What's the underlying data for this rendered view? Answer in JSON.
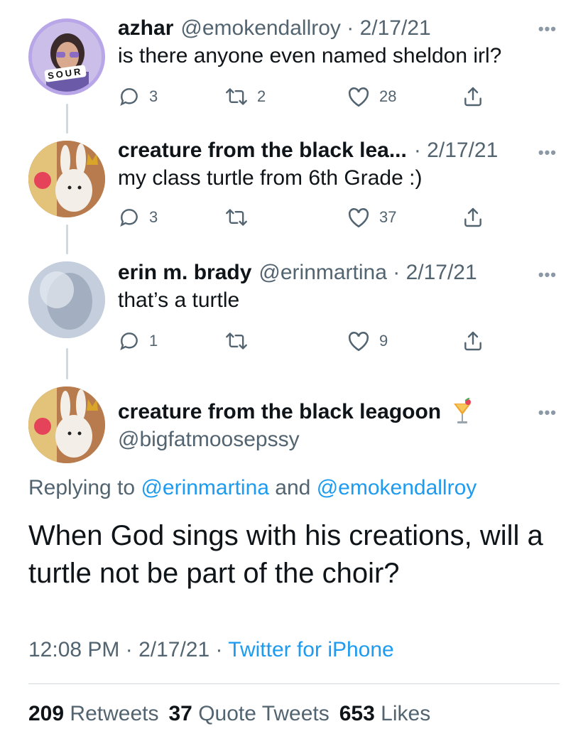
{
  "thread": [
    {
      "name": "azhar",
      "handle_date": "@emokendallroy · 2/17/21",
      "text": "is there anyone even named sheldon irl?",
      "replies": "3",
      "retweets": "2",
      "likes": "28",
      "avatar_badge": "SOUR"
    },
    {
      "name": "creature from the black lea...",
      "handle_date": "· 2/17/21",
      "text": "my class turtle from 6th Grade :)",
      "replies": "3",
      "retweets": "",
      "likes": "37"
    },
    {
      "name": "erin m. brady",
      "handle_date": "@erinmartina · 2/17/21",
      "text": "that’s a turtle",
      "replies": "1",
      "retweets": "",
      "likes": "9"
    }
  ],
  "main": {
    "name": "creature from the black leagoon",
    "handle": "@bigfatmoosepssy",
    "replying_prefix": "Replying to",
    "mention1": "@erinmartina",
    "and": "and",
    "mention2": "@emokendallroy",
    "text": "When God sings with his creations, will a turtle not be part of the choir?",
    "time_date": "12:08 PM · 2/17/21 ·",
    "source": "Twitter for iPhone",
    "retweets_count": "209",
    "retweets_label": "Retweets",
    "quotes_count": "37",
    "quotes_label": "Quote Tweets",
    "likes_count": "653",
    "likes_label": "Likes"
  },
  "more_glyph": "•••",
  "colors": {
    "link": "#1d9bf0",
    "secondary": "#536471",
    "text": "#0f1419"
  }
}
